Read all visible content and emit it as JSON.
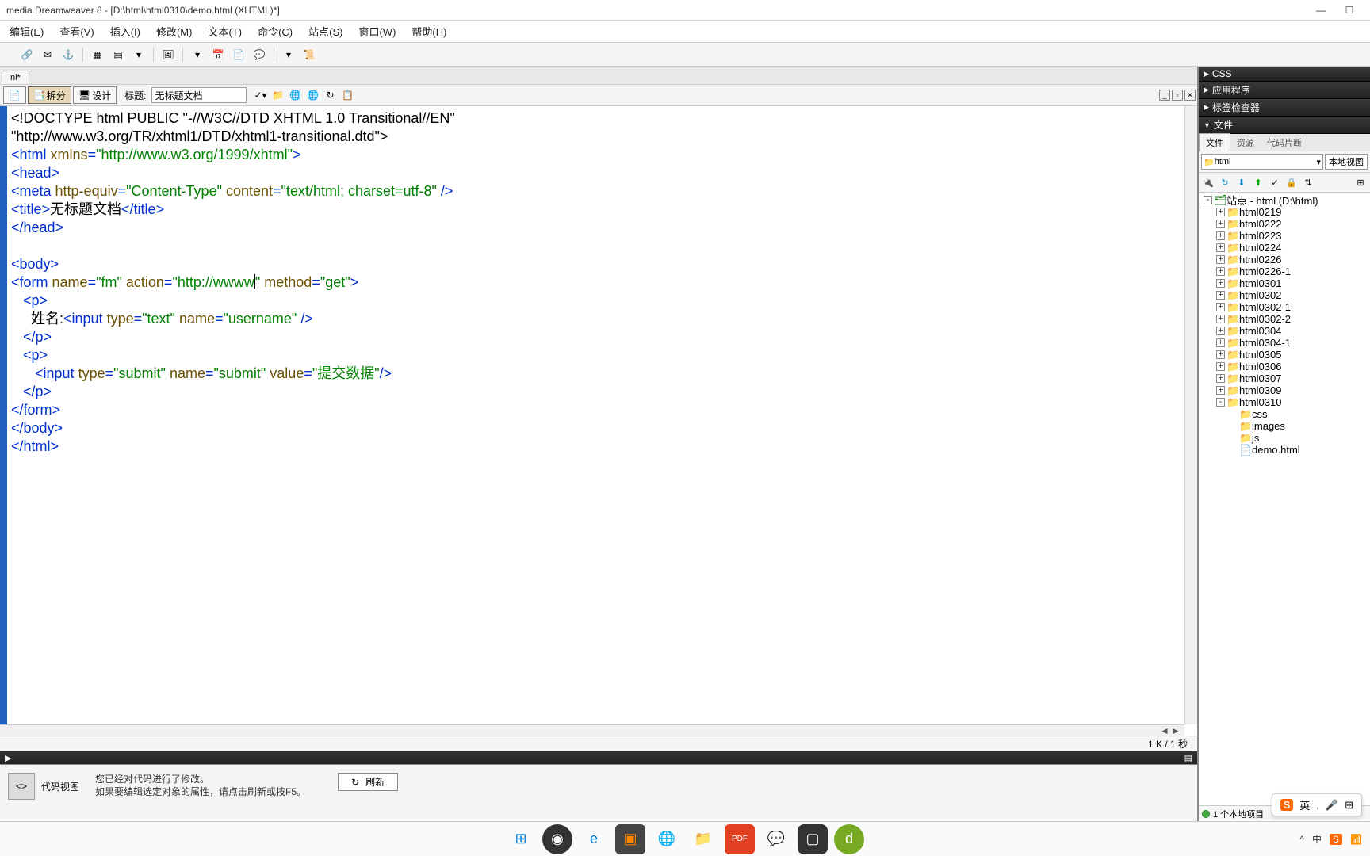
{
  "window": {
    "title": "media Dreamweaver 8 - [D:\\html\\html0310\\demo.html (XHTML)*]",
    "minimize": "—",
    "maximize": "☐"
  },
  "menu": {
    "edit": "编辑(E)",
    "view": "查看(V)",
    "insert": "插入(I)",
    "modify": "修改(M)",
    "text": "文本(T)",
    "commands": "命令(C)",
    "site": "站点(S)",
    "window": "窗口(W)",
    "help": "帮助(H)"
  },
  "doc_tab": "nl*",
  "view_buttons": {
    "split": "拆分",
    "design": "设计"
  },
  "title_label": "标题:",
  "title_input": "无标题文档",
  "code_lines": [
    [
      {
        "k": "",
        "t": "<!DOCTYPE html PUBLIC \"-//W3C//DTD XHTML 1.0 Transitional//EN\""
      }
    ],
    [
      {
        "k": "",
        "t": "\"http://www.w3.org/TR/xhtml1/DTD/xhtml1-transitional.dtd\">"
      }
    ],
    [
      {
        "k": "tag",
        "t": "<html"
      },
      {
        "k": "",
        "t": " "
      },
      {
        "k": "attr",
        "t": "xmlns"
      },
      {
        "k": "tag",
        "t": "="
      },
      {
        "k": "val",
        "t": "\"http://www.w3.org/1999/xhtml\""
      },
      {
        "k": "tag",
        "t": ">"
      }
    ],
    [
      {
        "k": "tag",
        "t": "<head>"
      }
    ],
    [
      {
        "k": "tag",
        "t": "<meta"
      },
      {
        "k": "",
        "t": " "
      },
      {
        "k": "attr",
        "t": "http-equiv"
      },
      {
        "k": "tag",
        "t": "="
      },
      {
        "k": "val",
        "t": "\"Content-Type\""
      },
      {
        "k": "",
        "t": " "
      },
      {
        "k": "attr",
        "t": "content"
      },
      {
        "k": "tag",
        "t": "="
      },
      {
        "k": "val",
        "t": "\"text/html; charset=utf-8\""
      },
      {
        "k": "",
        "t": " "
      },
      {
        "k": "tag",
        "t": "/>"
      }
    ],
    [
      {
        "k": "tag",
        "t": "<title>"
      },
      {
        "k": "",
        "t": "无标题文档"
      },
      {
        "k": "tag",
        "t": "</title>"
      }
    ],
    [
      {
        "k": "tag",
        "t": "</head>"
      }
    ],
    [
      {
        "k": "",
        "t": ""
      }
    ],
    [
      {
        "k": "tag",
        "t": "<body>"
      }
    ],
    [
      {
        "k": "tag",
        "t": "<form"
      },
      {
        "k": "",
        "t": " "
      },
      {
        "k": "attr",
        "t": "name"
      },
      {
        "k": "tag",
        "t": "="
      },
      {
        "k": "val",
        "t": "\"fm\""
      },
      {
        "k": "",
        "t": " "
      },
      {
        "k": "attr",
        "t": "action"
      },
      {
        "k": "tag",
        "t": "="
      },
      {
        "k": "val",
        "t": "\"http://wwww"
      },
      {
        "k": "cursor",
        "t": ""
      },
      {
        "k": "val",
        "t": "\""
      },
      {
        "k": "",
        "t": " "
      },
      {
        "k": "attr",
        "t": "method"
      },
      {
        "k": "tag",
        "t": "="
      },
      {
        "k": "val",
        "t": "\"get\""
      },
      {
        "k": "tag",
        "t": ">"
      }
    ],
    [
      {
        "k": "",
        "t": "   "
      },
      {
        "k": "tag",
        "t": "<p>"
      }
    ],
    [
      {
        "k": "",
        "t": "     姓名:"
      },
      {
        "k": "tag",
        "t": "<input"
      },
      {
        "k": "",
        "t": " "
      },
      {
        "k": "attr",
        "t": "type"
      },
      {
        "k": "tag",
        "t": "="
      },
      {
        "k": "val",
        "t": "\"text\""
      },
      {
        "k": "",
        "t": " "
      },
      {
        "k": "attr",
        "t": "name"
      },
      {
        "k": "tag",
        "t": "="
      },
      {
        "k": "val",
        "t": "\"username\""
      },
      {
        "k": "",
        "t": " "
      },
      {
        "k": "tag",
        "t": "/>"
      }
    ],
    [
      {
        "k": "",
        "t": "   "
      },
      {
        "k": "tag",
        "t": "</p>"
      }
    ],
    [
      {
        "k": "",
        "t": "   "
      },
      {
        "k": "tag",
        "t": "<p>"
      }
    ],
    [
      {
        "k": "",
        "t": "      "
      },
      {
        "k": "tag",
        "t": "<input"
      },
      {
        "k": "",
        "t": " "
      },
      {
        "k": "attr",
        "t": "type"
      },
      {
        "k": "tag",
        "t": "="
      },
      {
        "k": "val",
        "t": "\"submit\""
      },
      {
        "k": "",
        "t": " "
      },
      {
        "k": "attr",
        "t": "name"
      },
      {
        "k": "tag",
        "t": "="
      },
      {
        "k": "val",
        "t": "\"submit\""
      },
      {
        "k": "",
        "t": " "
      },
      {
        "k": "attr",
        "t": "value"
      },
      {
        "k": "tag",
        "t": "="
      },
      {
        "k": "val",
        "t": "\"提交数据\""
      },
      {
        "k": "tag",
        "t": "/>"
      }
    ],
    [
      {
        "k": "",
        "t": "   "
      },
      {
        "k": "tag",
        "t": "</p>"
      }
    ],
    [
      {
        "k": "tag",
        "t": "</form>"
      }
    ],
    [
      {
        "k": "tag",
        "t": "</body>"
      }
    ],
    [
      {
        "k": "tag",
        "t": "</html>"
      }
    ]
  ],
  "status": "1 K / 1 秒",
  "properties": {
    "title": "代码视图",
    "text1": "您已经对代码进行了修改。",
    "text2": "如果要编辑选定对象的属性，请点击刷新或按F5。",
    "refresh": "刷新"
  },
  "right_panels": {
    "css": "CSS",
    "app": "应用程序",
    "tags": "标签检查器",
    "files": "文件"
  },
  "files_tabs": {
    "files": "文件",
    "assets": "资源",
    "snippets": "代码片断"
  },
  "site_select": "html",
  "view_mode": "本地视图",
  "tree": [
    {
      "depth": 0,
      "exp": "-",
      "icon": "site",
      "label": "站点 - html (D:\\html)"
    },
    {
      "depth": 1,
      "exp": "+",
      "icon": "folder",
      "label": "html0219"
    },
    {
      "depth": 1,
      "exp": "+",
      "icon": "folder",
      "label": "html0222"
    },
    {
      "depth": 1,
      "exp": "+",
      "icon": "folder",
      "label": "html0223"
    },
    {
      "depth": 1,
      "exp": "+",
      "icon": "folder",
      "label": "html0224"
    },
    {
      "depth": 1,
      "exp": "+",
      "icon": "folder",
      "label": "html0226"
    },
    {
      "depth": 1,
      "exp": "+",
      "icon": "folder",
      "label": "html0226-1"
    },
    {
      "depth": 1,
      "exp": "+",
      "icon": "folder",
      "label": "html0301"
    },
    {
      "depth": 1,
      "exp": "+",
      "icon": "folder",
      "label": "html0302"
    },
    {
      "depth": 1,
      "exp": "+",
      "icon": "folder",
      "label": "html0302-1"
    },
    {
      "depth": 1,
      "exp": "+",
      "icon": "folder",
      "label": "html0302-2"
    },
    {
      "depth": 1,
      "exp": "+",
      "icon": "folder",
      "label": "html0304"
    },
    {
      "depth": 1,
      "exp": "+",
      "icon": "folder",
      "label": "html0304-1"
    },
    {
      "depth": 1,
      "exp": "+",
      "icon": "folder",
      "label": "html0305"
    },
    {
      "depth": 1,
      "exp": "+",
      "icon": "folder",
      "label": "html0306"
    },
    {
      "depth": 1,
      "exp": "+",
      "icon": "folder",
      "label": "html0307"
    },
    {
      "depth": 1,
      "exp": "+",
      "icon": "folder",
      "label": "html0309"
    },
    {
      "depth": 1,
      "exp": "-",
      "icon": "folder",
      "label": "html0310"
    },
    {
      "depth": 2,
      "exp": "",
      "icon": "folder",
      "label": "css"
    },
    {
      "depth": 2,
      "exp": "",
      "icon": "folder",
      "label": "images"
    },
    {
      "depth": 2,
      "exp": "",
      "icon": "folder",
      "label": "js"
    },
    {
      "depth": 2,
      "exp": "",
      "icon": "html",
      "label": "demo.html"
    }
  ],
  "files_status": "1 个本地项目",
  "ime": {
    "lang": "英",
    "mic": "🎤"
  },
  "tray": {
    "up": "^",
    "cn": "中",
    "sogou": "S",
    "net": "📶"
  }
}
